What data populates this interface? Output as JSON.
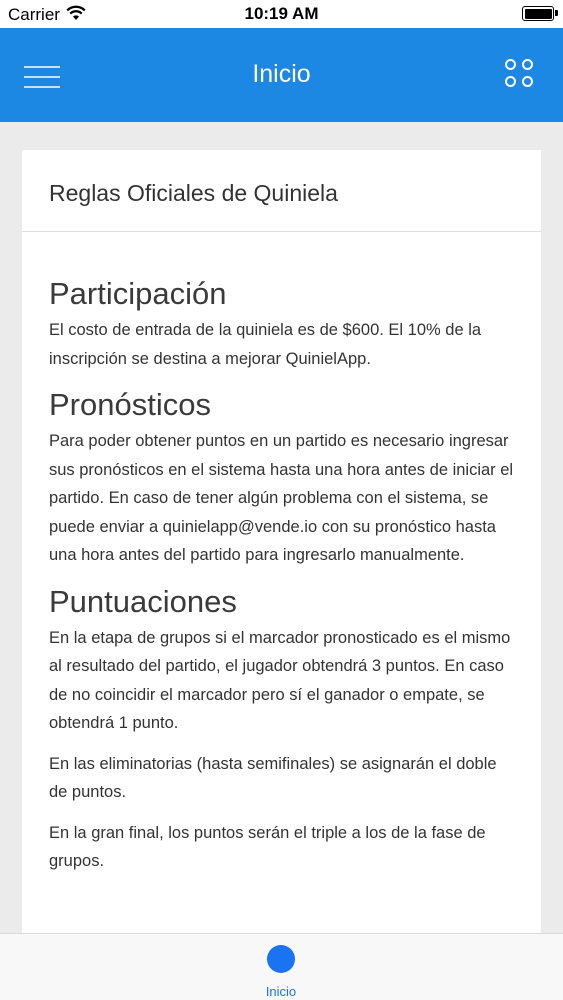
{
  "status_bar": {
    "carrier": "Carrier",
    "time": "10:19 AM",
    "wifi_icon": "wifi-icon",
    "battery_icon": "battery-icon"
  },
  "header": {
    "title": "Inicio",
    "menu_icon": "hamburger-menu-icon",
    "apps_icon": "grid-dots-icon",
    "background_color": "#1d87e4"
  },
  "card": {
    "title": "Reglas Oficiales de Quiniela",
    "sections": [
      {
        "heading": "Participación",
        "paragraphs": [
          "El costo de entrada de la quiniela es de $600. El 10% de la inscripción se destina a mejorar QuinielApp."
        ]
      },
      {
        "heading": "Pronósticos",
        "paragraphs": [
          "Para poder obtener puntos en un partido es necesario ingresar sus pronósticos en el sistema hasta una hora antes de iniciar el partido. En caso de tener algún problema con el sistema, se puede enviar a quinielapp@vende.io con su pronóstico hasta una hora antes del partido para ingresarlo manualmente."
        ]
      },
      {
        "heading": "Puntuaciones",
        "paragraphs": [
          "En la etapa de grupos si el marcador pronosticado es el mismo al resultado del partido, el jugador obtendrá 3 puntos. En caso de no coincidir el marcador pero sí el ganador o empate, se obtendrá 1 punto.",
          "En las eliminatorias (hasta semifinales) se asignarán el doble de puntos.",
          "En la gran final, los puntos serán el triple a los de la fase de grupos."
        ]
      }
    ]
  },
  "tab_bar": {
    "items": [
      {
        "label": "Inicio",
        "active": true,
        "color": "#1a73f0"
      }
    ]
  }
}
